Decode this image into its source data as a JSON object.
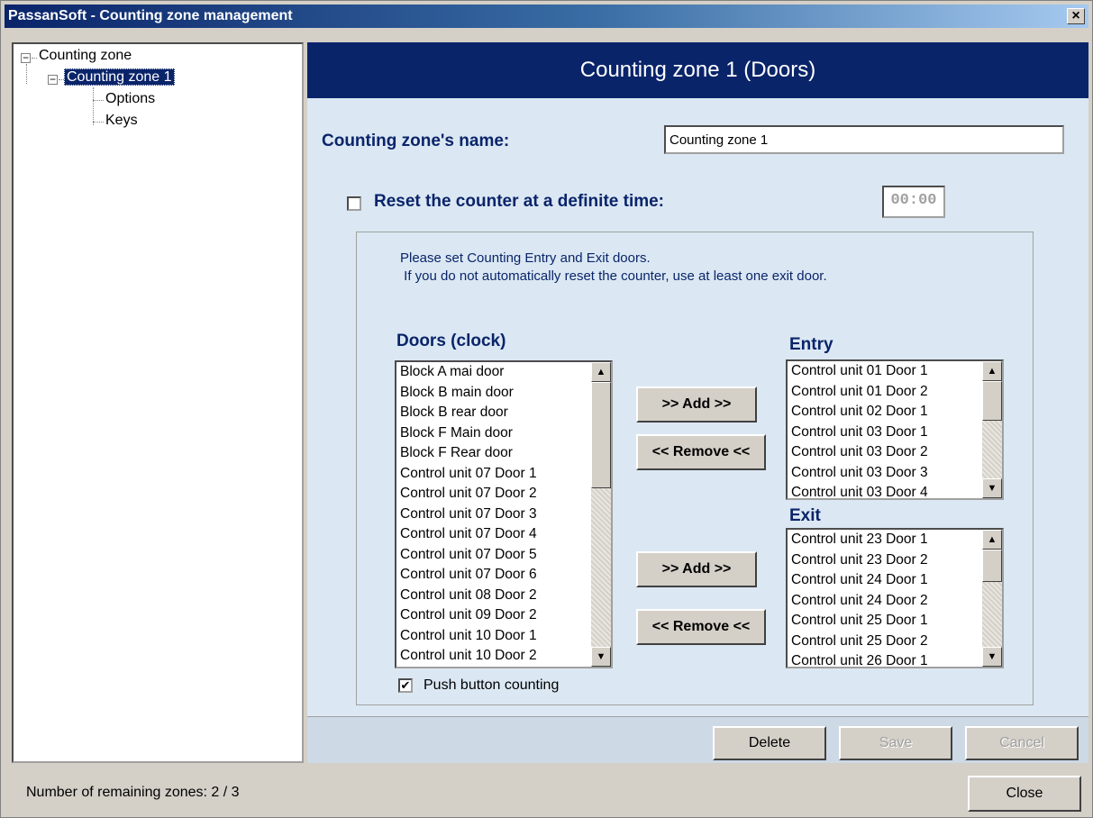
{
  "window": {
    "title": "PassanSoft - Counting zone management",
    "close_glyph": "×"
  },
  "tree": {
    "root": "Counting zone",
    "zone": "Counting zone 1",
    "children": [
      "Options",
      "Keys"
    ]
  },
  "panel": {
    "header": "Counting zone 1 (Doors)",
    "name_label": "Counting zone's name:",
    "name_value": "Counting zone 1",
    "reset_label": "Reset the counter at a definite time:",
    "reset_checked": false,
    "reset_time": "00:00",
    "info_lines": [
      "Please set Counting Entry and Exit doors.",
      " If you do not automatically reset the counter, use at least one exit door."
    ],
    "doors_title": "Doors (clock)",
    "doors": [
      "Block A mai door",
      "Block B main door",
      "Block B rear door",
      "Block F Main door",
      "Block F Rear door",
      "Control unit 07 Door 1",
      "Control unit 07 Door 2",
      "Control unit 07 Door 3",
      "Control unit 07 Door 4",
      "Control unit 07 Door 5",
      "Control unit 07 Door 6",
      "Control unit 08 Door 2",
      "Control unit 09 Door 2",
      "Control unit 10 Door 1",
      "Control unit 10 Door 2"
    ],
    "entry_title": "Entry",
    "entry": [
      "Control unit 01 Door 1",
      "Control unit 01 Door 2",
      "Control unit 02 Door 1",
      "Control unit 03 Door 1",
      "Control unit 03 Door 2",
      "Control unit 03 Door 3",
      "Control unit 03 Door 4"
    ],
    "exit_title": "Exit",
    "exit": [
      "Control unit 23 Door 1",
      "Control unit 23 Door 2",
      "Control unit 24 Door 1",
      "Control unit 24 Door 2",
      "Control unit 25 Door 1",
      "Control unit 25 Door 2",
      "Control unit 26 Door 1"
    ],
    "add_label": ">> Add >>",
    "remove_label": "<< Remove <<",
    "push_label": "Push button counting",
    "push_checked": true,
    "check_glyph": "✔",
    "delete_label": "Delete",
    "save_label": "Save",
    "cancel_label": "Cancel"
  },
  "status": {
    "text": "Number of remaining zones: 2 / 3",
    "close_label": "Close"
  }
}
